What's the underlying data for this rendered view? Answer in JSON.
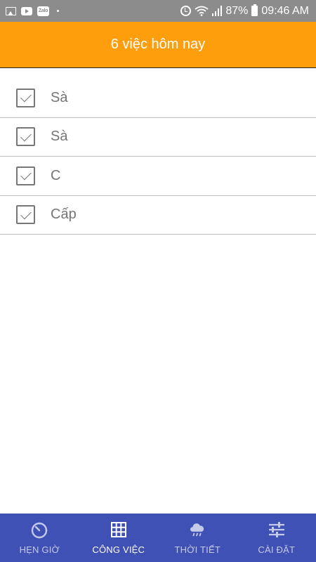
{
  "status_bar": {
    "battery_text": "87%",
    "time": "09:46 AM",
    "left_icons": [
      "gallery-icon",
      "youtube-icon",
      "zalo-icon",
      "dot-icon"
    ],
    "zalo_label": "Zalo",
    "right_icons": [
      "alarm-icon",
      "wifi-icon",
      "signal-icon",
      "battery-icon"
    ]
  },
  "app_bar": {
    "title": "6 việc hôm nay",
    "background": "#ff9e0d"
  },
  "tasks": [
    {
      "text": "Sà",
      "checked": true
    },
    {
      "text": "Sà",
      "checked": true
    },
    {
      "text": "C",
      "checked": true
    },
    {
      "text": "Cấp",
      "checked": true
    }
  ],
  "bottom_nav": {
    "background": "#3f51b5",
    "items": [
      {
        "label": "HẸN GIỜ",
        "icon": "timer-icon",
        "active": false
      },
      {
        "label": "CÔNG VIỆC",
        "icon": "grid-icon",
        "active": true
      },
      {
        "label": "THỜI TIẾT",
        "icon": "weather-cloud-icon",
        "active": false
      },
      {
        "label": "CÀI ĐẶT",
        "icon": "settings-sliders-icon",
        "active": false
      }
    ]
  }
}
